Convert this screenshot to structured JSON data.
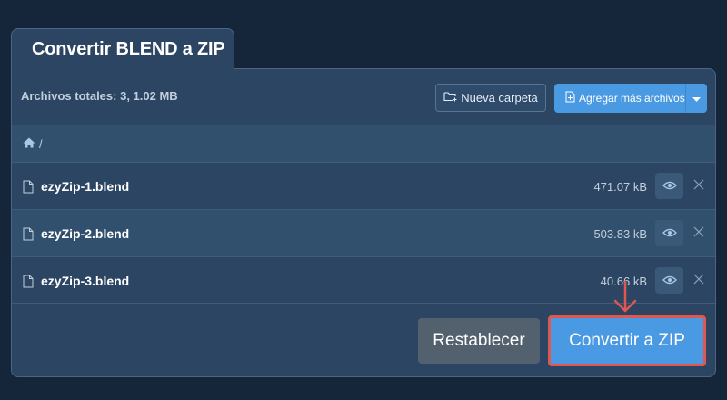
{
  "tab": {
    "title": "Convertir BLEND a ZIP"
  },
  "toolbar": {
    "total_label": "Archivos totales: 3, 1.02 MB",
    "new_folder_label": "Nueva carpeta",
    "add_files_label": "Agregar más archivos"
  },
  "breadcrumb": {
    "path": "/"
  },
  "files": [
    {
      "name": "ezyZip-1.blend",
      "size": "471.07 kB"
    },
    {
      "name": "ezyZip-2.blend",
      "size": "503.83 kB"
    },
    {
      "name": "ezyZip-3.blend",
      "size": "40.66 kB"
    }
  ],
  "actions": {
    "reset_label": "Restablecer",
    "convert_label": "Convertir a ZIP"
  },
  "colors": {
    "background": "#15253a",
    "panel": "#2b4563",
    "accent": "#4a9ae3",
    "highlight": "#e0574f",
    "secondary_button": "#53606e"
  }
}
